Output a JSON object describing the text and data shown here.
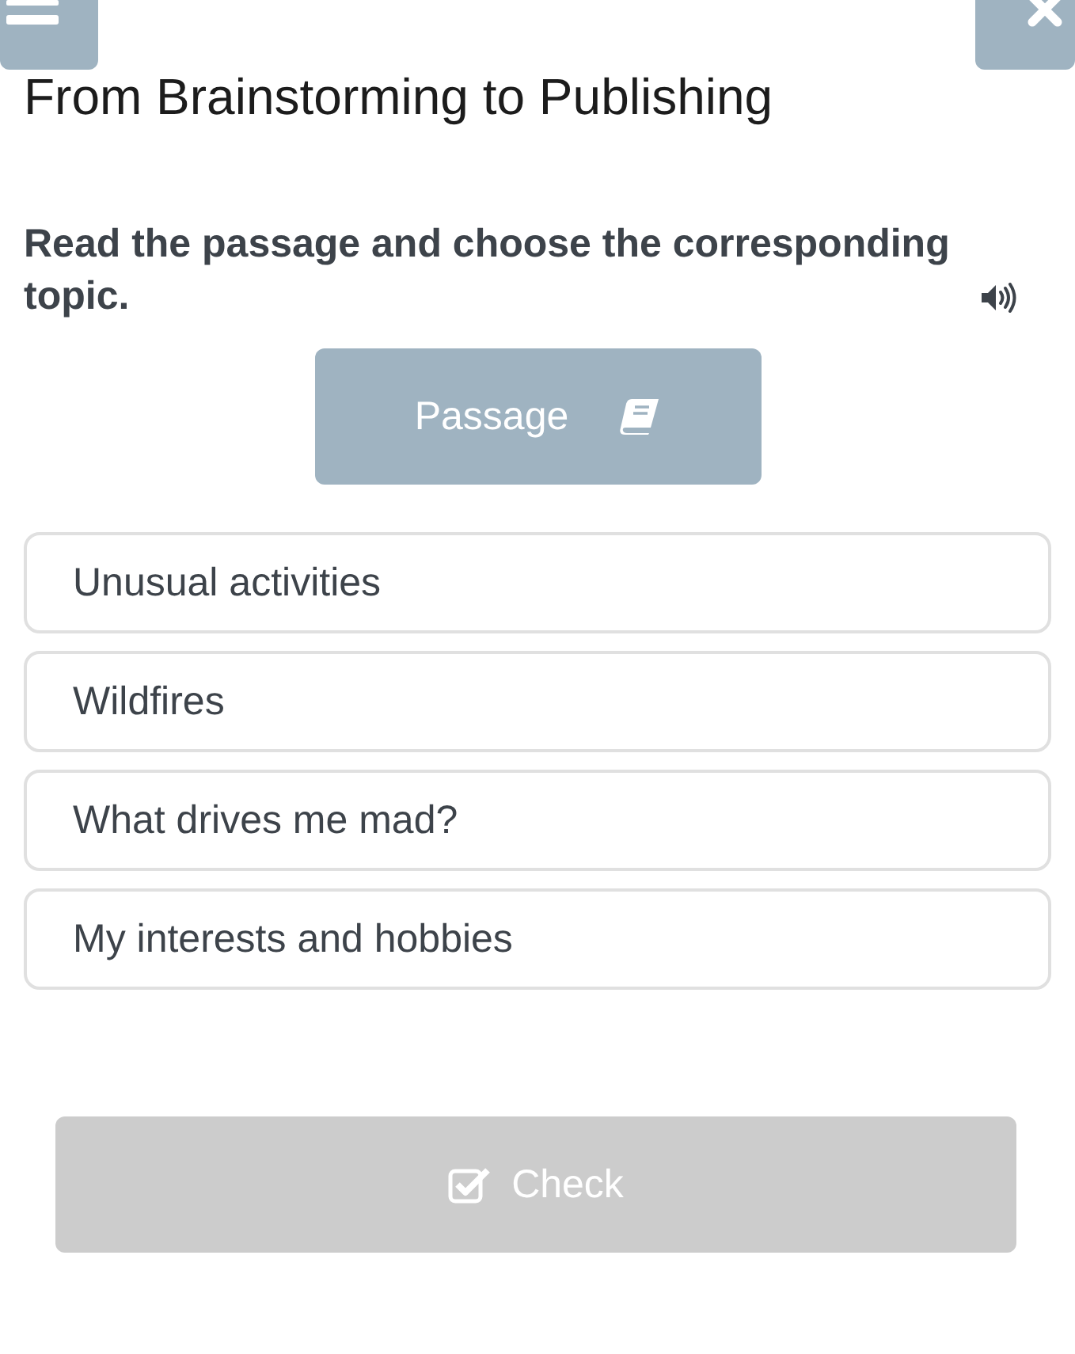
{
  "title": "From Brainstorming to Publishing",
  "instruction": "Read the passage and choose the corresponding topic.",
  "passage_button": {
    "label": "Passage"
  },
  "options": [
    {
      "label": "Unusual activities",
      "selected": false
    },
    {
      "label": "Wildfires",
      "selected": false
    },
    {
      "label": "What drives me mad?",
      "selected": false
    },
    {
      "label": "My interests and hobbies",
      "selected": false
    }
  ],
  "check_button": {
    "label": "Check",
    "disabled": true
  }
}
